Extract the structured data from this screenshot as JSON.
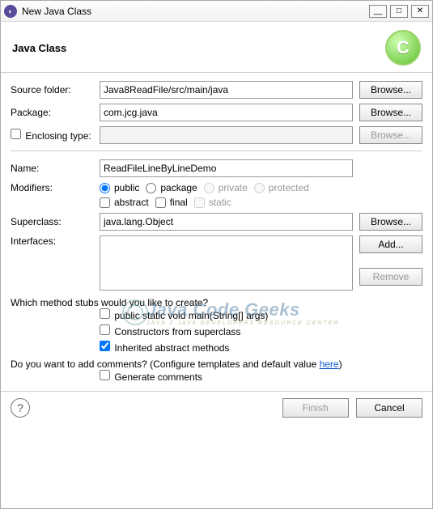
{
  "window": {
    "title": "New Java Class"
  },
  "header": {
    "title": "Java Class",
    "iconLetter": "C"
  },
  "labels": {
    "sourceFolder": "Source folder:",
    "package": "Package:",
    "enclosingType": "Enclosing type:",
    "name": "Name:",
    "modifiers": "Modifiers:",
    "superclass": "Superclass:",
    "interfaces": "Interfaces:"
  },
  "fields": {
    "sourceFolder": "Java8ReadFile/src/main/java",
    "package": "com.jcg.java",
    "enclosingType": "",
    "name": "ReadFileLineByLineDemo",
    "superclass": "java.lang.Object"
  },
  "modifiers": {
    "public": "public",
    "package": "package",
    "private": "private",
    "protected": "protected",
    "abstract": "abstract",
    "final": "final",
    "static": "static"
  },
  "buttons": {
    "browse": "Browse...",
    "add": "Add...",
    "remove": "Remove",
    "finish": "Finish",
    "cancel": "Cancel"
  },
  "stubs": {
    "question": "Which method stubs would you like to create?",
    "main": "public static void main(String[] args)",
    "constructors": "Constructors from superclass",
    "inherited": "Inherited abstract methods"
  },
  "comments": {
    "questionPrefix": "Do you want to add comments? (Configure templates and default value ",
    "hereLink": "here",
    "questionSuffix": ")",
    "generate": "Generate comments"
  },
  "watermark": {
    "line1": "Java Code Geeks",
    "line2": "JAVA 2 JAVA DEVELOPERS RESOURCE CENTER"
  }
}
